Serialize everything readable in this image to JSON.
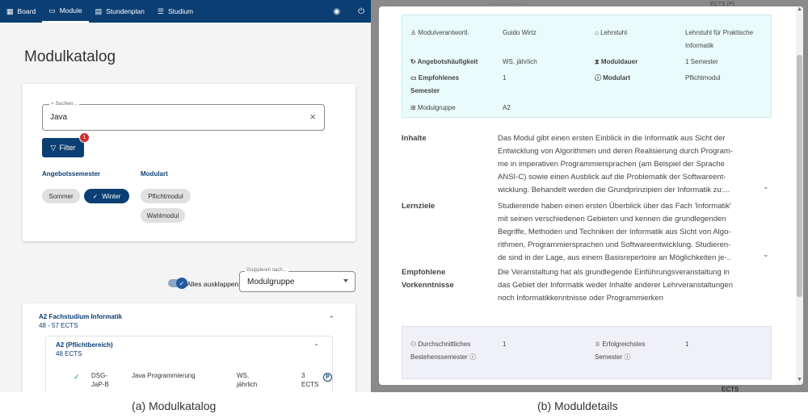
{
  "catalog": {
    "nav": {
      "items": [
        {
          "icon": "board-icon",
          "glyph": "▦",
          "label": "Board"
        },
        {
          "icon": "module-icon",
          "glyph": "▭",
          "label": "Module"
        },
        {
          "icon": "calendar-icon",
          "glyph": "▤",
          "label": "Stundenplan"
        },
        {
          "icon": "list-icon",
          "glyph": "☰",
          "label": "Studium"
        }
      ],
      "active": "Module",
      "account_icon": "account-icon",
      "power_icon": "power-icon"
    },
    "title": "Modulkatalog",
    "search": {
      "label": "Suchen...",
      "value": "Java"
    },
    "filter": {
      "label": "Filter",
      "badge": "1"
    },
    "semester_group": {
      "title": "Angebotssemester",
      "options": [
        "Sommer",
        "Winter"
      ],
      "selected": "Winter"
    },
    "type_group": {
      "title": "Modulart",
      "options": [
        "Pflichtmodul",
        "Wahlmodul"
      ]
    },
    "expand_all": {
      "label": "Alles ausklappen",
      "on": true
    },
    "group_by": {
      "label": "Gruppieren nach...",
      "value": "Modulgruppe"
    },
    "group": {
      "title": "A2 Fachstudium Informatik",
      "ects": "48 - 57 ECTS",
      "subgroup": {
        "title": "A2 (Pflichtbereich)",
        "ects": "48 ECTS",
        "module": {
          "code_line1": "DSG-",
          "code_line2": "JaP-B",
          "name": "Java Programmierung",
          "freq_line1": "WS,",
          "freq_line2": "jährlich",
          "ects_line1": "3",
          "ects_line2": "ECTS",
          "badge": "P"
        }
      }
    },
    "caption": "(a) Modulkatalog"
  },
  "details": {
    "background": {
      "text1": "·····················",
      "text2": "ECTS (P)",
      "text3": "ECTS"
    },
    "info": {
      "responsible": {
        "label": "Modulverantwortl.",
        "value": "Guido Wirtz"
      },
      "chair": {
        "label": "Lehrstuhl",
        "value_line1": "Lehrstuhl für Praktische",
        "value_line2": "Informatik"
      },
      "frequency": {
        "label": "Angebotshäufigkeit",
        "value": "WS, jährlich"
      },
      "duration": {
        "label": "Moduldauer",
        "value": "1 Semester"
      },
      "semester": {
        "label_line1": "Empfohlenes",
        "label_line2": "Semester",
        "value": "1"
      },
      "type": {
        "label": "Modulart",
        "value": "Pflichtmodul"
      },
      "group": {
        "label": "Modulgruppe",
        "value": "A2"
      }
    },
    "sections": [
      {
        "label_line1": "Inhalte",
        "label_line2": "",
        "lines": [
          "Das Modul gibt einen ersten Einblick in die Informatik aus Sicht der",
          "Entwicklung von Algorithmen und deren Realisierung durch Program-",
          "me in imperativen Programmiersprachen (am Beispiel der Sprache",
          "ANSI-C) sowie einen Ausblick auf die Problematik der Softwareent-",
          "wicklung. Behandelt werden die Grundprinzipien der Informatik zu:..."
        ],
        "expandable": true
      },
      {
        "label_line1": "Lernziele",
        "label_line2": "",
        "lines": [
          "Studierende haben einen ersten Überblick über das Fach 'Informatik'",
          "mit seinen verschiedenen Gebieten und kennen die grundlegenden",
          "Begriffe, Methoden und Techniken der Informatik aus Sicht von Algo-",
          "rithmen, Programmiersprachen und Softwareentwicklung. Studieren-",
          "de sind in der Lage, aus einem Basisrepertoire an Möglichkeiten je-.."
        ],
        "expandable": true
      },
      {
        "label_line1": "Empfohlene",
        "label_line2": "Vorkenntnisse",
        "lines": [
          "Die Veranstaltung hat als grundlegende Einführungsveranstaltung in",
          "das Gebiet der Informatik weder Inhalte anderer Lehrveranstaltungen",
          "noch Informatikkenntnisse oder Programmierken"
        ],
        "expandable": false
      }
    ],
    "stats": {
      "avg": {
        "label_line1": "Durchschnittliches",
        "label_line2": "Bestehenssemester",
        "value": "1"
      },
      "success": {
        "label_line1": "Erfolgreichstes",
        "label_line2": "Semester",
        "value": "1"
      }
    },
    "caption": "(b) Moduldetails"
  }
}
